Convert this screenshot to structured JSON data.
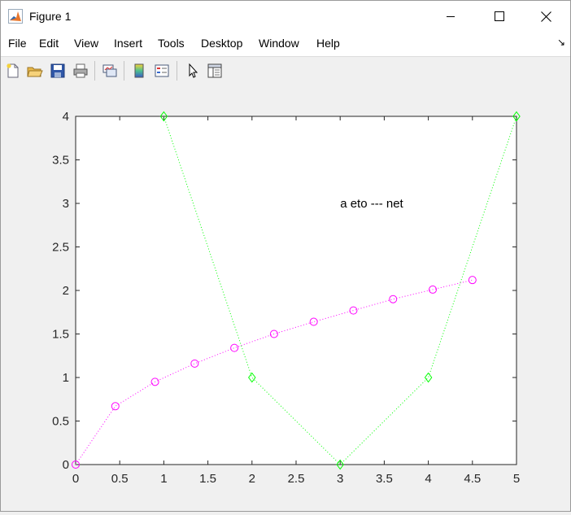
{
  "window": {
    "title": "Figure 1"
  },
  "menu": [
    "File",
    "Edit",
    "View",
    "Insert",
    "Tools",
    "Desktop",
    "Window",
    "Help"
  ],
  "toolbar": {
    "buttons": [
      "new-figure-icon",
      "open-file-icon",
      "save-icon",
      "print-icon",
      "link-plot-icon",
      "colorbar-icon",
      "legend-icon",
      "edit-plot-icon",
      "property-inspector-icon"
    ]
  },
  "colors": {
    "series1": "#ff00ff",
    "series2": "#00ff00",
    "axes_bg": "#ffffff",
    "figure_bg": "#f0f0f0"
  },
  "chart_data": {
    "type": "line",
    "title": "",
    "xlabel": "",
    "ylabel": "",
    "xlim": [
      0,
      5
    ],
    "ylim": [
      0,
      4
    ],
    "xticks": [
      "0",
      "0.5",
      "1",
      "1.5",
      "2",
      "2.5",
      "3",
      "3.5",
      "4",
      "4.5",
      "5"
    ],
    "yticks": [
      "0",
      "0.5",
      "1",
      "1.5",
      "2",
      "2.5",
      "3",
      "3.5",
      "4"
    ],
    "grid": false,
    "annotation": {
      "text": "a eto --- net",
      "x": 3,
      "y": 3
    },
    "series": [
      {
        "line": "dotted",
        "marker": "circle",
        "color": "#ff00ff",
        "x": [
          0,
          0.45,
          0.9,
          1.35,
          1.8,
          2.25,
          2.7,
          3.15,
          3.6,
          4.05,
          4.5
        ],
        "y": [
          0,
          0.67,
          0.95,
          1.16,
          1.34,
          1.5,
          1.64,
          1.77,
          1.9,
          2.01,
          2.12
        ]
      },
      {
        "line": "dotted",
        "marker": "diamond",
        "color": "#00ff00",
        "x": [
          1,
          2,
          3,
          4,
          5
        ],
        "y": [
          4,
          1,
          0,
          1,
          4
        ]
      }
    ]
  }
}
